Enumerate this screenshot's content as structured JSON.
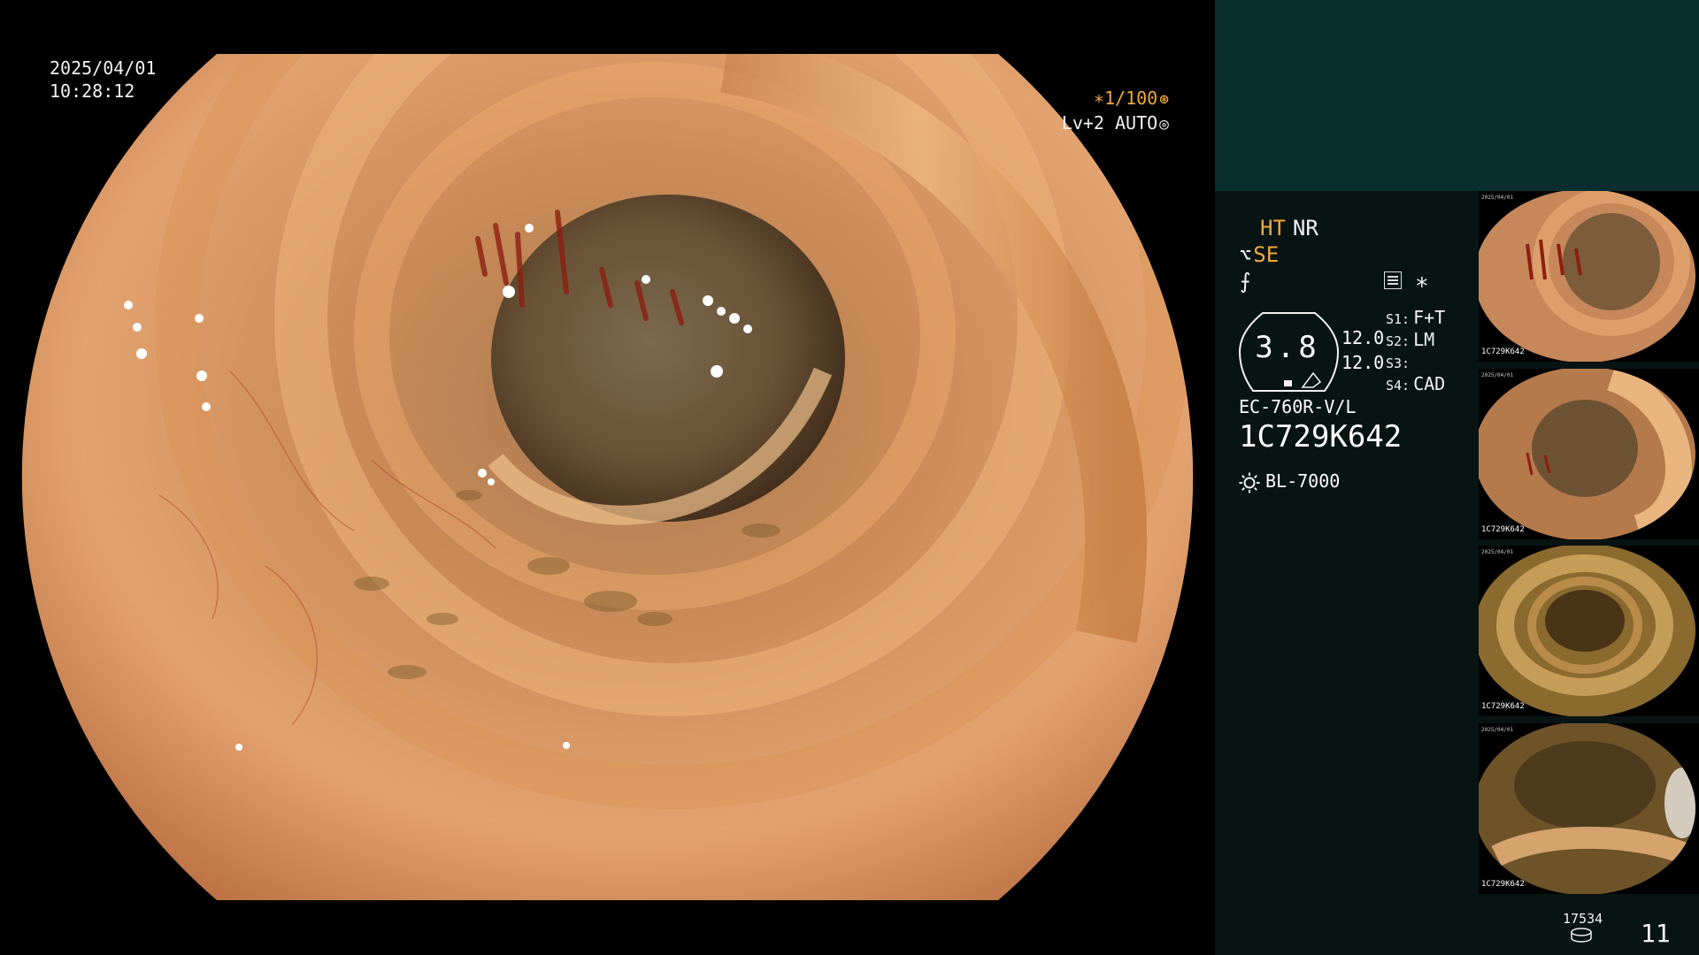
{
  "overlay": {
    "date": "2025/04/01",
    "time": "10:28:12",
    "shutter": "∗1/100",
    "level_auto": "Lv+2 AUTO"
  },
  "panel": {
    "ht": "HT",
    "nr": "NR",
    "se": "SE",
    "gauge_value": "3.8",
    "gauge_reading_1": "12.0",
    "gauge_reading_2": "12.0",
    "s_settings": [
      {
        "key": "S1:",
        "value": "F+T"
      },
      {
        "key": "S2:",
        "value": "LM"
      },
      {
        "key": "S3:",
        "value": ""
      },
      {
        "key": "S4:",
        "value": "CAD"
      }
    ],
    "scope_model": "EC-760R-V/L",
    "scope_serial": "1C729K642",
    "light_source": "BL-7000"
  },
  "thumbnails": [
    {
      "code": "1C729K642",
      "date": "2025/04/01"
    },
    {
      "code": "1C729K642",
      "date": "2025/04/01"
    },
    {
      "code": "1C729K642",
      "date": "2025/04/01"
    },
    {
      "code": "1C729K642",
      "date": "2025/04/01"
    }
  ],
  "footer": {
    "storage_count": "17534",
    "image_count": "11"
  },
  "icons": [
    "shutter-icon",
    "auto-iris-icon",
    "structure-enhance-icon",
    "freeze-icon",
    "menu-icon",
    "star-icon",
    "light-source-icon",
    "storage-icon"
  ],
  "colors": {
    "accent_orange": "#f0a93c",
    "panel_bg": "#081414",
    "panel_header_bg": "#0a2e2e"
  }
}
